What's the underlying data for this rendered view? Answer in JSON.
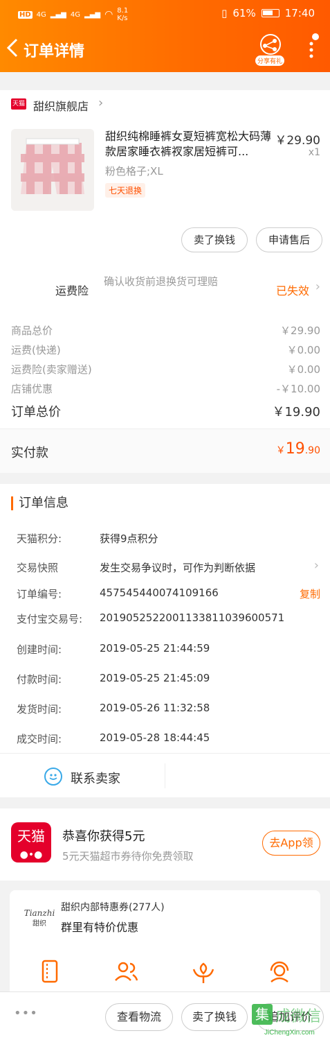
{
  "status_bar": {
    "network": "HD",
    "signal1": "4G",
    "signal2": "4G",
    "speed_value": "8.1",
    "speed_unit": "K/s",
    "battery": "61%",
    "time": "17:40"
  },
  "nav": {
    "title": "订单详情",
    "share_badge": "分享有礼"
  },
  "shop": {
    "badge": "天猫",
    "name": "甜织旗舰店"
  },
  "product": {
    "title": "甜织纯棉睡裤女夏短裤宽松大码薄款居家睡衣裤衩家居短裤可...",
    "price": "￥29.90",
    "qty": "x1",
    "sku": "粉色格子;XL",
    "tag": "七天退换",
    "sell_btn": "卖了换钱",
    "aftersale_btn": "申请售后"
  },
  "insurance": {
    "label": "运费险",
    "desc": "确认收货前退换货可理赔",
    "status": "已失效"
  },
  "costs": [
    {
      "label": "商品总价",
      "value": "￥29.90"
    },
    {
      "label": "运费(快递)",
      "value": "￥0.00"
    },
    {
      "label": "运费险(卖家赠送)",
      "value": "￥0.00"
    },
    {
      "label": "店铺优惠",
      "value": "-￥10.00"
    }
  ],
  "order_total": {
    "label": "订单总价",
    "value": "￥19.90"
  },
  "paid": {
    "label": "实付款",
    "currency": "￥",
    "int": "19",
    "dec": ".90"
  },
  "order_info": {
    "title": "订单信息",
    "rows": [
      {
        "key": "天猫积分:",
        "value": "获得9点积分"
      },
      {
        "key": "交易快照",
        "value": "发生交易争议时，可作为判断依据"
      },
      {
        "key": "订单编号:",
        "value": "457545440074109166",
        "action": "复制"
      },
      {
        "key": "支付宝交易号:",
        "value": "2019052522001133811039600571"
      },
      {
        "key": "创建时间:",
        "value": "2019-05-25 21:44:59"
      },
      {
        "key": "付款时间:",
        "value": "2019-05-25 21:45:09"
      },
      {
        "key": "发货时间:",
        "value": "2019-05-26 11:32:58"
      },
      {
        "key": "成交时间:",
        "value": "2019-05-28 18:44:45"
      }
    ],
    "contact": "联系卖家"
  },
  "promo": {
    "logo": "天猫",
    "title": "恭喜你获得5元",
    "subtitle": "5元天猫超市券待你免费领取",
    "button": "去App领"
  },
  "coupon": {
    "brand": "Tianzhi",
    "brand_cn": "甜织",
    "title": "甜织内部特惠券(277人)",
    "subtitle": "群里有特价优惠"
  },
  "bottom": {
    "more": "•••",
    "logistics": "查看物流",
    "sell": "卖了换钱",
    "review": "追加评价"
  },
  "watermark": {
    "char": "集",
    "text": "成微信",
    "url": "JiChengXin.com"
  }
}
